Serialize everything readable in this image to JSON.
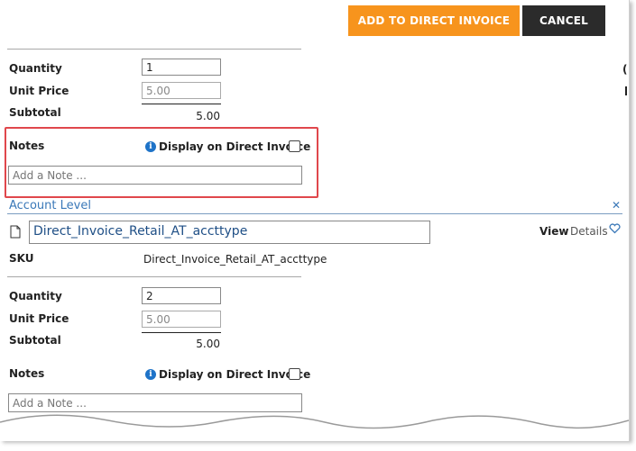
{
  "toolbar": {
    "add_label": "ADD TO DIRECT INVOICE",
    "cancel_label": "CANCEL"
  },
  "item1": {
    "quantity_label": "Quantity",
    "quantity_value": "1",
    "unit_price_label": "Unit Price",
    "unit_price_value": "5.00",
    "subtotal_label": "Subtotal",
    "subtotal_value": "5.00",
    "notes_label": "Notes",
    "display_label": "Display on Direct Invoice",
    "note_placeholder": "Add a Note ..."
  },
  "section": {
    "title": "Account Level"
  },
  "item2": {
    "product_name": "Direct_Invoice_Retail_AT_accttype",
    "view_label": "View",
    "details_label": "Details",
    "sku_label": "SKU",
    "sku_value": "Direct_Invoice_Retail_AT_accttype",
    "quantity_label": "Quantity",
    "quantity_value": "2",
    "unit_price_label": "Unit Price",
    "unit_price_value": "5.00",
    "subtotal_label": "Subtotal",
    "subtotal_value": "5.00",
    "notes_label": "Notes",
    "display_label": "Display on Direct Invoice",
    "note_placeholder": "Add a Note ..."
  },
  "icons": {
    "info": "info-icon",
    "document": "document-icon",
    "heart": "heart-icon",
    "chevron": "chevron-right-icon"
  },
  "colors": {
    "primary_button": "#f7941d",
    "cancel_button": "#2b2b2b",
    "highlight": "#e0474c",
    "section_title": "#3a78b8",
    "product_link": "#1f4f86",
    "info_icon": "#1e73c8"
  }
}
